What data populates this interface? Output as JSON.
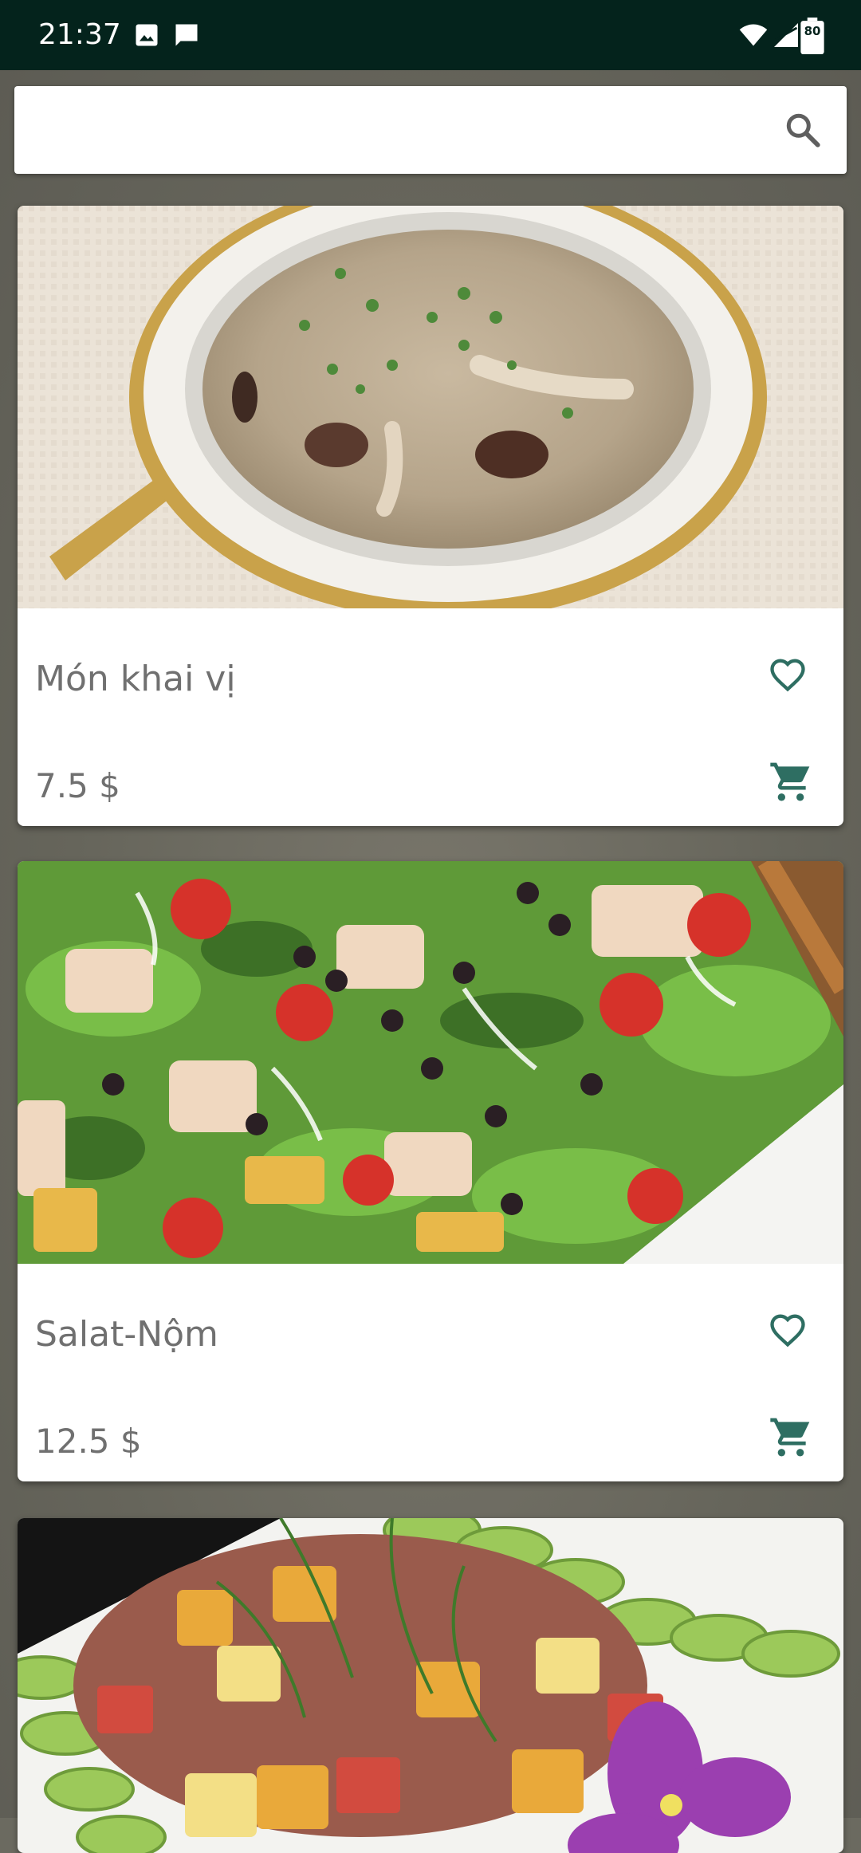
{
  "status_bar": {
    "time": "21:37",
    "battery_level": "80",
    "icons": [
      "image-icon",
      "message-icon",
      "wifi-icon",
      "signal-icon",
      "battery-icon"
    ]
  },
  "search": {
    "value": "",
    "placeholder": "",
    "icon": "search-icon"
  },
  "colors": {
    "accent": "#2e6e62",
    "status_bar_bg": "#04231c",
    "text_muted": "#707070"
  },
  "items": [
    {
      "name": "Món khai vị",
      "price": "7.5 $",
      "image": "soup-photo",
      "favorite_icon": "heart-outline-icon",
      "cart_icon": "cart-icon"
    },
    {
      "name": "Salat-Nộm",
      "price": "12.5 $",
      "image": "salad-photo",
      "favorite_icon": "heart-outline-icon",
      "cart_icon": "cart-icon"
    },
    {
      "name": "",
      "price": "",
      "image": "fruit-salad-photo"
    }
  ]
}
